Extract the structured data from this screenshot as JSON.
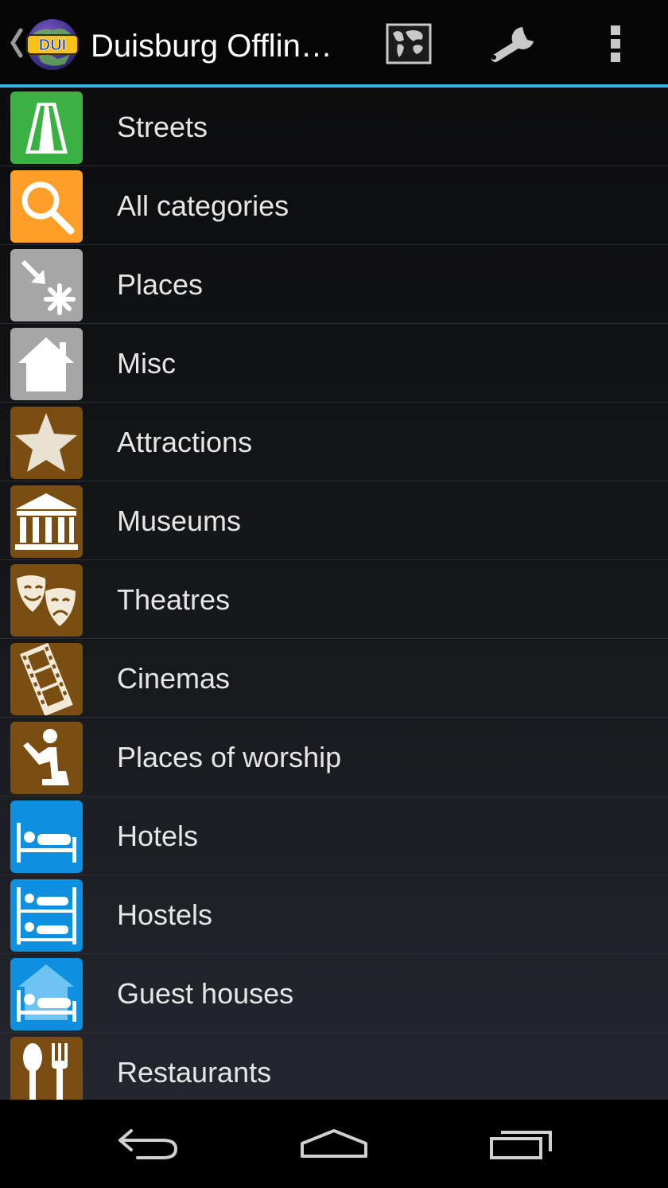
{
  "action_bar": {
    "title": "Duisburg Offlin…",
    "logo_text": "DUI",
    "accent_color": "#33b5e5",
    "buttons": [
      "map-icon",
      "wrench-icon",
      "overflow-menu-icon"
    ]
  },
  "categories": [
    {
      "label": "Streets",
      "icon": "road-icon",
      "color": "#3bb143"
    },
    {
      "label": "All categories",
      "icon": "magnifier-icon",
      "color": "#ff9f2a"
    },
    {
      "label": "Places",
      "icon": "places-icon",
      "color": "#a6a6a6"
    },
    {
      "label": "Misc",
      "icon": "house-icon",
      "color": "#a6a6a6"
    },
    {
      "label": "Attractions",
      "icon": "star-icon",
      "color": "#7a4d12"
    },
    {
      "label": "Museums",
      "icon": "museum-icon",
      "color": "#7a4d12"
    },
    {
      "label": "Theatres",
      "icon": "theatre-masks-icon",
      "color": "#7a4d12"
    },
    {
      "label": "Cinemas",
      "icon": "film-strip-icon",
      "color": "#7a4d12"
    },
    {
      "label": "Places of worship",
      "icon": "praying-person-icon",
      "color": "#7a4d12"
    },
    {
      "label": "Hotels",
      "icon": "bed-icon",
      "color": "#0e8fe0"
    },
    {
      "label": "Hostels",
      "icon": "bunk-bed-icon",
      "color": "#0e8fe0"
    },
    {
      "label": "Guest houses",
      "icon": "guest-house-icon",
      "color": "#0e8fe0"
    },
    {
      "label": "Restaurants",
      "icon": "fork-spoon-icon",
      "color": "#7a4d12"
    }
  ],
  "nav_bar": [
    "back-icon",
    "home-icon",
    "recent-apps-icon"
  ]
}
